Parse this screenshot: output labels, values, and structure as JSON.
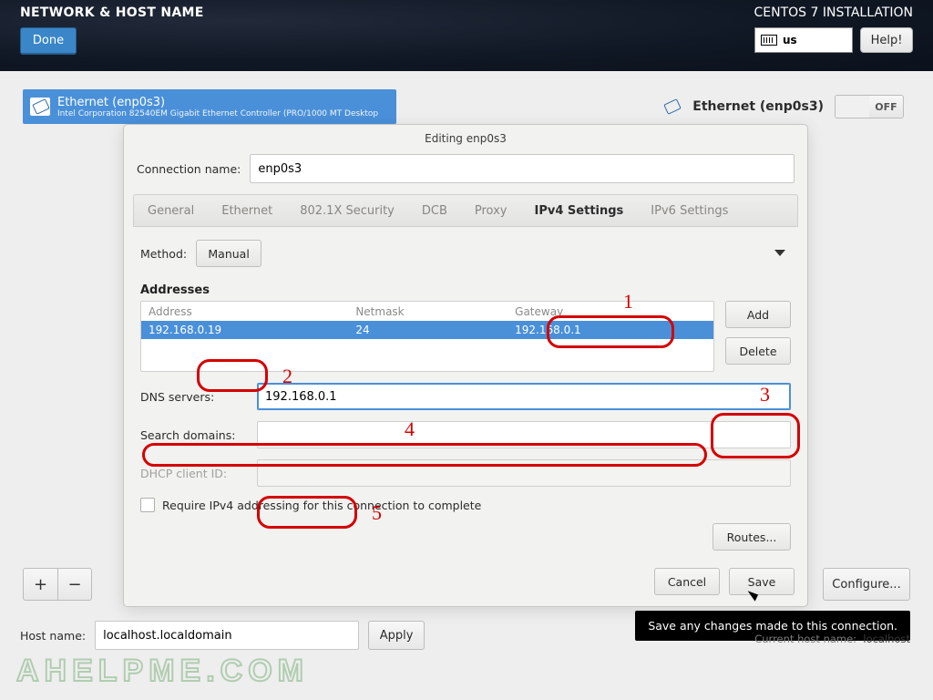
{
  "header": {
    "title": "NETWORK & HOST NAME",
    "done": "Done",
    "right_title": "CENTOS 7 INSTALLATION",
    "keyboard_layout": "us",
    "help": "Help!"
  },
  "device": {
    "name": "Ethernet (enp0s3)",
    "vendor": "Intel Corporation 82540EM Gigabit Ethernet Controller (PRO/1000 MT Desktop",
    "right_title": "Ethernet (enp0s3)",
    "switch_state": "OFF"
  },
  "listctrl": {
    "add": "+",
    "remove": "−"
  },
  "configure": "Configure...",
  "dialog": {
    "title": "Editing enp0s3",
    "conn_label": "Connection name:",
    "conn_value": "enp0s3",
    "tabs": [
      "General",
      "Ethernet",
      "802.1X Security",
      "DCB",
      "Proxy",
      "IPv4 Settings",
      "IPv6 Settings"
    ],
    "active_tab": 5,
    "method_label": "Method:",
    "method_value": "Manual",
    "addresses_title": "Addresses",
    "columns": [
      "Address",
      "Netmask",
      "Gateway"
    ],
    "row": {
      "address": "192.168.0.19",
      "netmask": "24",
      "gateway": "192.168.0.1"
    },
    "add": "Add",
    "delete": "Delete",
    "dns_label": "DNS servers:",
    "dns_value": "192.168.0.1",
    "search_label": "Search domains:",
    "search_value": "",
    "dhcp_label": "DHCP client ID:",
    "dhcp_value": "",
    "require_label": "Require IPv4 addressing for this connection to complete",
    "routes": "Routes...",
    "cancel": "Cancel",
    "save": "Save"
  },
  "tooltip": "Save any changes made to this connection.",
  "hostname": {
    "label": "Host name:",
    "value": "localhost.localdomain",
    "apply": "Apply",
    "current_label": "Current host name:",
    "current_value": "localhost"
  },
  "watermark": "AHELPME.COM",
  "annotations": {
    "n1": "1",
    "n2": "2",
    "n3": "3",
    "n4": "4",
    "n5": "5"
  }
}
